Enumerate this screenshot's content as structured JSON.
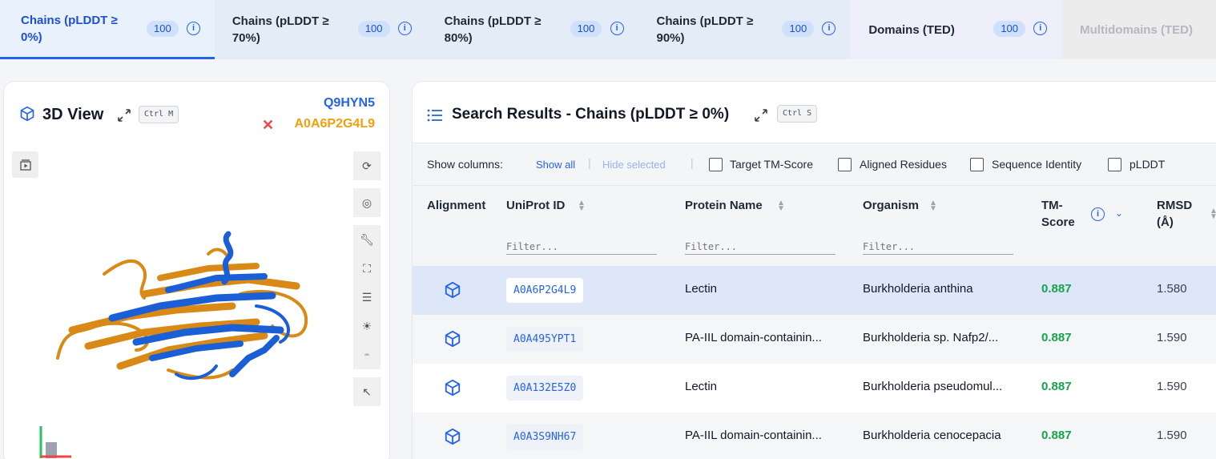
{
  "tabs": [
    {
      "label_line1": "Chains (pLDDT ≥",
      "label_line2": "0%)",
      "count": "100",
      "active": true
    },
    {
      "label_line1": "Chains (pLDDT ≥",
      "label_line2": "70%)",
      "count": "100"
    },
    {
      "label_line1": "Chains (pLDDT ≥",
      "label_line2": "80%)",
      "count": "100"
    },
    {
      "label_line1": "Chains (pLDDT ≥",
      "label_line2": "90%)",
      "count": "100"
    },
    {
      "label_line1": "Domains (TED)",
      "label_line2": "",
      "count": "100"
    },
    {
      "label_line1": "Multidomains (TED)",
      "label_line2": "",
      "disabled": true
    }
  ],
  "viewer": {
    "title": "3D View",
    "shortcut": "Ctrl M",
    "query_id": "Q9HYN5",
    "target_id": "A0A6P2G4L9",
    "query_color": "#2563eb",
    "target_color": "#f59e0b",
    "tools": [
      "reset-icon",
      "camera-icon",
      "wrench-icon",
      "fullscreen-icon",
      "sliders-icon",
      "light-icon",
      "vr-icon",
      "pointer-icon"
    ]
  },
  "results": {
    "title": "Search Results - Chains (pLDDT ≥ 0%)",
    "shortcut": "Ctrl S",
    "show_columns_label": "Show columns:",
    "show_all": "Show all",
    "hide_selected": "Hide selected",
    "optional_columns": [
      "Target TM-Score",
      "Aligned Residues",
      "Sequence Identity",
      "pLDDT"
    ],
    "columns": {
      "alignment": "Alignment",
      "uniprot": "UniProt ID",
      "protein": "Protein Name",
      "organism": "Organism",
      "tm_line1": "TM-",
      "tm_line2": "Score",
      "rmsd_line1": "RMSD",
      "rmsd_line2": "(Å)"
    },
    "filter_placeholder": "Filter...",
    "rows": [
      {
        "uniprot": "A0A6P2G4L9",
        "protein": "Lectin",
        "organism": "Burkholderia anthina",
        "tm": "0.887",
        "rmsd": "1.580",
        "selected": true
      },
      {
        "uniprot": "A0A495YPT1",
        "protein": "PA-IIL domain-containin...",
        "organism": "Burkholderia sp. Nafp2/...",
        "tm": "0.887",
        "rmsd": "1.590"
      },
      {
        "uniprot": "A0A132E5Z0",
        "protein": "Lectin",
        "organism": "Burkholderia pseudomul...",
        "tm": "0.887",
        "rmsd": "1.590"
      },
      {
        "uniprot": "A0A3S9NH67",
        "protein": "PA-IIL domain-containin...",
        "organism": "Burkholderia cenocepacia",
        "tm": "0.887",
        "rmsd": "1.590"
      }
    ]
  }
}
